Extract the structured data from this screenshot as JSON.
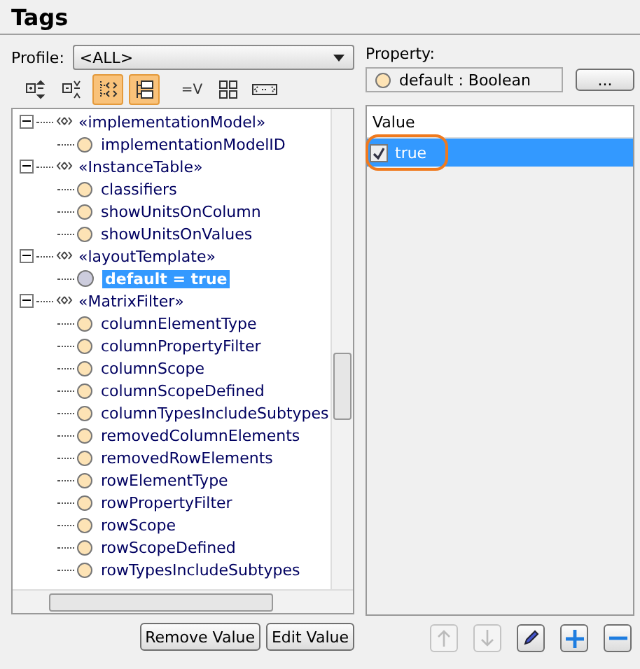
{
  "title": "Tags",
  "profile": {
    "label": "Profile:",
    "value": "<ALL>"
  },
  "toolbar": [
    {
      "kind": "expand",
      "selected": false
    },
    {
      "kind": "collapse",
      "selected": false
    },
    {
      "kind": "stereo",
      "selected": true
    },
    {
      "kind": "groups",
      "selected": true
    },
    {
      "kind": "text",
      "label": "=V",
      "selected": false
    },
    {
      "kind": "grid",
      "selected": false
    },
    {
      "kind": "field",
      "selected": false
    }
  ],
  "tree": [
    {
      "label": "«implementationModel»",
      "expanded": true,
      "children": [
        {
          "label": "implementationModelID",
          "kind": "property",
          "selected": false
        }
      ]
    },
    {
      "label": "«InstanceTable»",
      "expanded": true,
      "children": [
        {
          "label": "classifiers",
          "kind": "property",
          "selected": false
        },
        {
          "label": "showUnitsOnColumn",
          "kind": "property",
          "selected": false
        },
        {
          "label": "showUnitsOnValues",
          "kind": "property",
          "selected": false
        }
      ]
    },
    {
      "label": "«layoutTemplate»",
      "expanded": true,
      "children": [
        {
          "label": "default = true",
          "kind": "value",
          "selected": true
        }
      ]
    },
    {
      "label": "«MatrixFilter»",
      "expanded": true,
      "children": [
        {
          "label": "columnElementType",
          "kind": "property",
          "selected": false
        },
        {
          "label": "columnPropertyFilter",
          "kind": "property",
          "selected": false
        },
        {
          "label": "columnScope",
          "kind": "property",
          "selected": false
        },
        {
          "label": "columnScopeDefined",
          "kind": "property",
          "selected": false
        },
        {
          "label": "columnTypesIncludeSubtypes",
          "kind": "property",
          "selected": false
        },
        {
          "label": "removedColumnElements",
          "kind": "property",
          "selected": false
        },
        {
          "label": "removedRowElements",
          "kind": "property",
          "selected": false
        },
        {
          "label": "rowElementType",
          "kind": "property",
          "selected": false
        },
        {
          "label": "rowPropertyFilter",
          "kind": "property",
          "selected": false
        },
        {
          "label": "rowScope",
          "kind": "property",
          "selected": false
        },
        {
          "label": "rowScopeDefined",
          "kind": "property",
          "selected": false
        },
        {
          "label": "rowTypesIncludeSubtypes",
          "kind": "property",
          "selected": false
        }
      ]
    }
  ],
  "left_buttons": [
    "Remove Value",
    "Edit Value"
  ],
  "property": {
    "label": "Property:",
    "value": "default : Boolean",
    "button": "..."
  },
  "values": {
    "column": "Value",
    "rows": [
      {
        "text": "true",
        "checked": true,
        "selected": true,
        "highlighted": true
      }
    ]
  },
  "right_buttons": [
    {
      "kind": "up",
      "disabled": true
    },
    {
      "kind": "down",
      "disabled": true
    },
    {
      "kind": "edit",
      "disabled": false
    },
    {
      "kind": "add",
      "disabled": false
    },
    {
      "kind": "remove",
      "disabled": false
    }
  ]
}
